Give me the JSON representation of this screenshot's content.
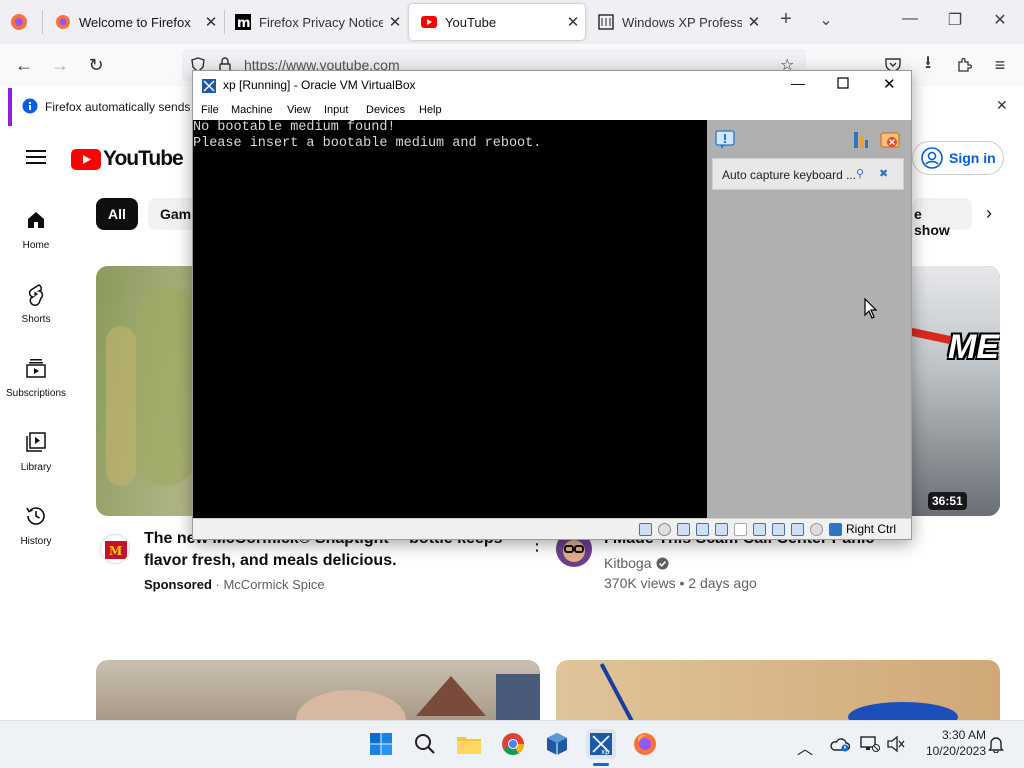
{
  "browser": {
    "tabs": [
      {
        "title": "Welcome to Firefox"
      },
      {
        "title": "Firefox Privacy Notice —"
      },
      {
        "title": "YouTube"
      },
      {
        "title": "Windows XP Professio"
      }
    ],
    "url": "https://www.youtube.com",
    "notification": "Firefox automatically sends"
  },
  "youtube": {
    "logo_text": "YouTube",
    "sign_in": "Sign in",
    "sidebar": [
      {
        "label": "Home"
      },
      {
        "label": "Shorts"
      },
      {
        "label": "Subscriptions"
      },
      {
        "label": "Library"
      },
      {
        "label": "History"
      }
    ],
    "chips": [
      "All",
      "Gami",
      "e show"
    ],
    "videos": [
      {
        "title_line1": "The new McCormick® Snaptight™ bottle keeps",
        "title_line2": "flavor fresh, and meals delicious.",
        "sponsored": "Sponsored",
        "channel": "· McCormick Spice"
      },
      {
        "title": "I Made This Scam Call Center Panic",
        "channel": "Kitboga",
        "stats": "370K views • 2 days ago",
        "duration": "36:51",
        "thumb_text": "ME"
      }
    ]
  },
  "virtualbox": {
    "title": "xp [Running] - Oracle VM VirtualBox",
    "menu": [
      "File",
      "Machine",
      "View",
      "Input",
      "Devices",
      "Help"
    ],
    "screen_lines": [
      "No bootable medium found!",
      "Please insert a bootable medium and reboot."
    ],
    "panel_notice": "Auto capture keyboard ...",
    "host_key": "Right Ctrl"
  },
  "taskbar": {
    "time": "3:30 AM",
    "date": "10/20/2023"
  },
  "colors": {
    "youtube_red": "#ff0000",
    "firefox_purple": "#8f1ee0",
    "signin_blue": "#065fd4"
  }
}
